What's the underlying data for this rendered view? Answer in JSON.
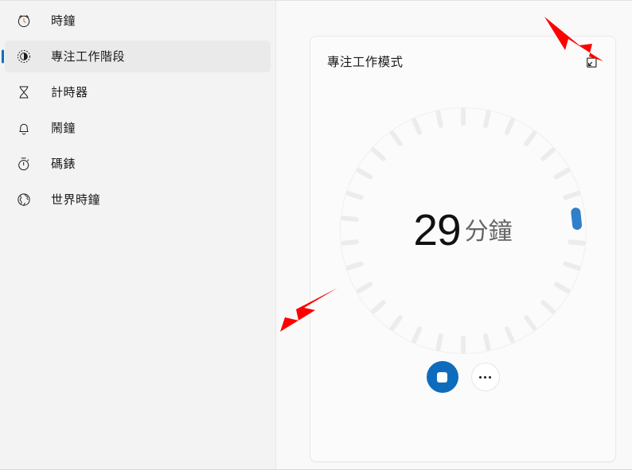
{
  "app": {
    "accent_color": "#0f6cbd",
    "dial_marker_color": "#2f80c8",
    "sidebar_bg": "#f3f3f3",
    "content_bg": "#f9f9f9",
    "card_bg": "#fbfbfb",
    "annotation_color": "#ff0000"
  },
  "sidebar": {
    "items": [
      {
        "label": "時鐘",
        "icon": "alarm-clock-icon",
        "selected": false
      },
      {
        "label": "專注工作階段",
        "icon": "focus-session-icon",
        "selected": true
      },
      {
        "label": "計時器",
        "icon": "hourglass-timer-icon",
        "selected": false
      },
      {
        "label": "鬧鐘",
        "icon": "bell-alarm-icon",
        "selected": false
      },
      {
        "label": "碼錶",
        "icon": "stopwatch-icon",
        "selected": false
      },
      {
        "label": "世界時鐘",
        "icon": "globe-world-clock-icon",
        "selected": false
      }
    ]
  },
  "card": {
    "title": "專注工作模式",
    "popout_icon": "pop-out-mini-view-icon"
  },
  "timer": {
    "value": "29",
    "unit": "分鐘",
    "total_ticks": 30,
    "active_tick_index": 7,
    "tick_step_degrees": 12
  },
  "actions": {
    "stop_label": "停止",
    "stop_icon": "stop-square-icon",
    "more_label": "更多選項",
    "more_icon": "more-ellipsis-icon"
  },
  "annotations": [
    {
      "name": "arrow-pointing-to-sidebar-item",
      "direction": "up-right"
    },
    {
      "name": "arrow-pointing-to-popout-button",
      "direction": "down-right"
    }
  ]
}
